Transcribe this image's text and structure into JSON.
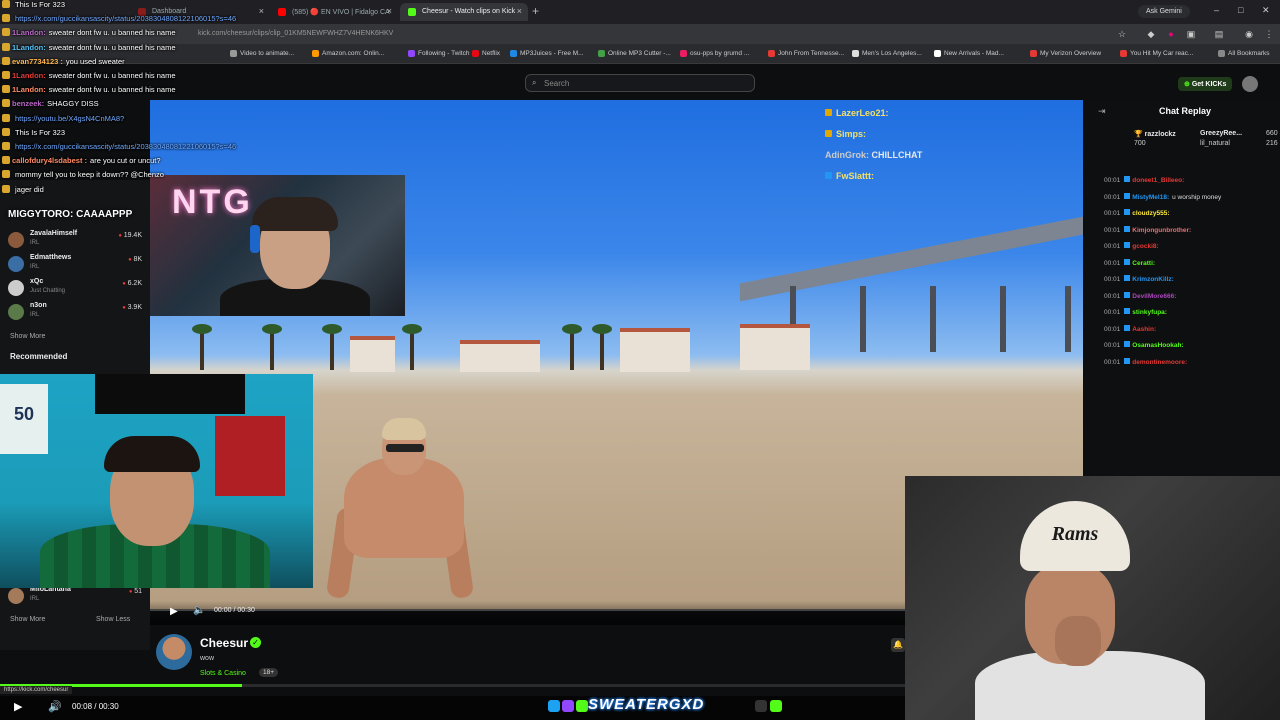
{
  "browser": {
    "tabs": [
      {
        "label": "Dashboard",
        "color": "#8a1c1c"
      },
      {
        "label": "(585) 🔴 EN VIVO | Fidalgo CA",
        "color": "#ff0000"
      },
      {
        "label": "Cheesur - Watch clips on Kick",
        "color": "#53fc18"
      }
    ],
    "new_tab": "+",
    "ask_gemini": "Ask Gemini",
    "url": "kick.com/cheesur/clips/clip_01KM5NEWFWHZ7V4HENK6HKV",
    "bookmarks": [
      {
        "label": "Video to animate...",
        "color": "#999999"
      },
      {
        "label": "Amazon.com: Onlin...",
        "color": "#ff9900"
      },
      {
        "label": "Following - Twitch",
        "color": "#9146ff"
      },
      {
        "label": "Netflix",
        "color": "#e50914"
      },
      {
        "label": "MP3Juices - Free M...",
        "color": "#1e88e5"
      },
      {
        "label": "Online MP3 Cutter -...",
        "color": "#43a047"
      },
      {
        "label": "osu-pps by grumd ...",
        "color": "#e91e63"
      },
      {
        "label": "John From Tennesse...",
        "color": "#e53935"
      },
      {
        "label": "Men's Los Angeles...",
        "color": "#dddddd"
      },
      {
        "label": "New Arrivals - Mad...",
        "color": "#ffffff"
      },
      {
        "label": "My Verizon Overview",
        "color": "#e53935"
      },
      {
        "label": "You Hit My Car reac...",
        "color": "#e53935"
      },
      {
        "label": "All Bookmarks",
        "color": "#888888"
      }
    ]
  },
  "kick": {
    "search_placeholder": "Search",
    "get_kicks": "Get KICKs",
    "video_chat": [
      {
        "user": "LazerLeo21:",
        "msg": ""
      },
      {
        "user": "Simps:",
        "msg": ""
      },
      {
        "user": "AdinGrok:",
        "msg": "CHILLCHAT"
      },
      {
        "user": "FwSlattt:",
        "msg": ""
      }
    ],
    "player": {
      "time": "00:00 / 00:30",
      "progress": 0.0
    },
    "streamer": {
      "name": "Cheesur",
      "title": "wow",
      "category": "Slots & Casino",
      "age": "18+"
    },
    "sidebar": {
      "channels": [
        {
          "name": "ZavalaHimself",
          "category": "IRL",
          "viewers": "19.4K",
          "avatar": "#8b5a3c"
        },
        {
          "name": "Edmatthews",
          "category": "IRL",
          "viewers": "8K",
          "avatar": "#3a6ea5"
        },
        {
          "name": "xQc",
          "category": "Just Chatting",
          "viewers": "6.2K",
          "avatar": "#cccccc"
        },
        {
          "name": "n3on",
          "category": "IRL",
          "viewers": "3.9K",
          "avatar": "#5a7a4a"
        }
      ],
      "show_more": "Show More",
      "recommended": "Recommended",
      "recommended_item": {
        "name": "MiloLantana",
        "category": "IRL",
        "viewers": "51"
      },
      "show_more_2": "Show More",
      "show_less": "Show Less"
    },
    "chat_replay": {
      "title": "Chat Replay",
      "gifters": [
        {
          "name": "razzlockz",
          "amount": "700"
        },
        {
          "name": "GreezyRee...",
          "amount": "660"
        },
        {
          "name": "lil_natural",
          "amount": "216"
        }
      ],
      "messages": [
        {
          "time": "00:01",
          "user": "doneet1_Billeeo:",
          "msg": "",
          "color": "#e53935"
        },
        {
          "time": "00:01",
          "user": "MistyMel18:",
          "msg": "u worship money",
          "color": "#2196f3"
        },
        {
          "time": "00:01",
          "user": "cloudzy555:",
          "msg": "",
          "color": "#ffeb3b"
        },
        {
          "time": "00:01",
          "user": "Kimjongunbrother:",
          "msg": "",
          "color": "#e57373"
        },
        {
          "time": "00:01",
          "user": "gcocki8:",
          "msg": "",
          "color": "#e53935"
        },
        {
          "time": "00:01",
          "user": "Ceratti:",
          "msg": "",
          "color": "#53fc18"
        },
        {
          "time": "00:01",
          "user": "KrimzonKillz:",
          "msg": "",
          "color": "#2196f3"
        },
        {
          "time": "00:01",
          "user": "DevilMore666:",
          "msg": "",
          "color": "#ab47bc"
        },
        {
          "time": "00:01",
          "user": "stinkyfupa:",
          "msg": "",
          "color": "#53fc18"
        },
        {
          "time": "00:01",
          "user": "Aashin:",
          "msg": "",
          "color": "#e53935"
        },
        {
          "time": "00:01",
          "user": "OsamasHookah:",
          "msg": "",
          "color": "#53fc18"
        },
        {
          "time": "00:01",
          "user": "demontinemoore:",
          "msg": "",
          "color": "#e53935"
        }
      ]
    }
  },
  "overlay_chat": [
    {
      "user": "",
      "msg": "This Is For 323",
      "link": false
    },
    {
      "user": "",
      "msg": "https://x.com/guccikansascity/status/2038304808122106015?s=46",
      "link": true
    },
    {
      "user": "1Landon:",
      "msg": "sweater dont fw u. u banned his name",
      "link": false
    },
    {
      "user": "1Landon:",
      "msg": "sweater dont fw u. u banned his name",
      "link": false
    },
    {
      "user": "evan7734123 :",
      "msg": "you used sweater",
      "link": false
    },
    {
      "user": "1Landon:",
      "msg": "sweater dont fw u. u banned his name",
      "link": false
    },
    {
      "user": "1Landon:",
      "msg": "sweater dont fw u. u banned his name",
      "link": false
    },
    {
      "user": "benzeek:",
      "msg": "SHAGGY DISS",
      "link": false
    },
    {
      "user": "",
      "msg": "https://youtu.be/X4gsN4CnMA8?",
      "link": true
    },
    {
      "user": "",
      "msg": "This Is For 323",
      "link": false
    },
    {
      "user": "",
      "msg": "https://x.com/guccikansascity/status/2038304808122106015?s=46",
      "link": true
    },
    {
      "user": "callofdury4lsdabest :",
      "msg": "are you cut or uncut?",
      "link": false
    },
    {
      "user": "",
      "msg": "mommy tell you to keep it down?? @Chenzo",
      "link": false
    },
    {
      "user": "",
      "msg": "jager did",
      "link": false
    }
  ],
  "overlay_name": "MIGGYTORO: CAAAAPPP",
  "bottom": {
    "hover_url": "https://kick.com/cheesur",
    "time": "00:08 / 00:30",
    "progress": 0.267,
    "social_handle": "SWEATERGXD"
  }
}
